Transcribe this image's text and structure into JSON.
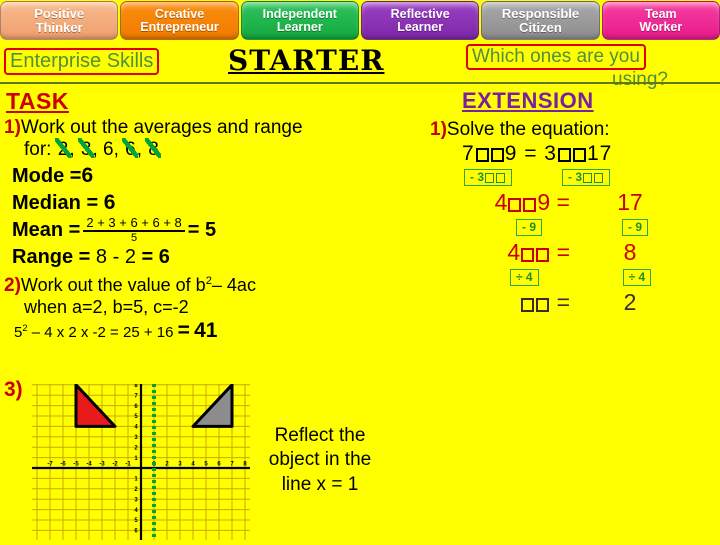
{
  "banner": {
    "skills": [
      {
        "line1": "Positive",
        "line2": "Thinker",
        "color": "#f0a070"
      },
      {
        "line1": "Creative",
        "line2": "Entrepreneur",
        "color": "#f07c00"
      },
      {
        "line1": "Independent",
        "line2": "Learner",
        "color": "#14a83f"
      },
      {
        "line1": "Reflective",
        "line2": "Learner",
        "color": "#7d28a8"
      },
      {
        "line1": "Responsible",
        "line2": "Citizen",
        "color": "#8d8d8d"
      },
      {
        "line1": "Team",
        "line2": "Worker",
        "color": "#e81a8c"
      }
    ]
  },
  "header": {
    "enterprise_skills": "Enterprise Skills",
    "starter": "STARTER",
    "which_ones_line1": "Which ones are you",
    "which_ones_line2": "using?"
  },
  "task": {
    "heading": "TASK",
    "q1_num": "1)",
    "q1_text": "Work out the averages and range",
    "q1_for_label": "for:",
    "q1_values": [
      "2",
      "3",
      "6",
      "6",
      "8"
    ],
    "q1_values_struck": [
      true,
      true,
      false,
      true,
      true
    ],
    "mode_label": "Mode =",
    "mode_value": "6",
    "median_label": "Median =",
    "median_value": "6",
    "mean_label": "Mean =",
    "mean_numerator": "2 + 3 + 6 + 6 + 8",
    "mean_denominator": "5",
    "mean_equals": "=",
    "mean_value": "5",
    "range_label": "Range =",
    "range_expr": "8 - 2",
    "range_equals": "=",
    "range_value": "6",
    "q2_num": "2)",
    "q2_text_pre": "Work out the value of b",
    "q2_sup": "2",
    "q2_text_post": "– 4ac",
    "q2_when": "when a=2, b=5, c=-2",
    "q2_work_base": "5",
    "q2_work_sup": "2",
    "q2_work_rest": "– 4 x 2 x -2 = 25 + 16",
    "q2_work_equals": "=",
    "q2_answer": "41",
    "q3_num": "3)"
  },
  "graph": {
    "x_ticks": [
      "-7",
      "-6",
      "-5",
      "-4",
      "-3",
      "-2",
      "-1",
      "1",
      "2",
      "3",
      "4",
      "5",
      "6",
      "7",
      "8"
    ],
    "y_ticks": [
      "8",
      "7",
      "6",
      "5",
      "4",
      "3",
      "2",
      "1",
      "1",
      "2",
      "3",
      "4",
      "5",
      "6"
    ],
    "x_range": [
      -8,
      8
    ],
    "y_range": [
      -7,
      9
    ],
    "mirror_line_label": "x = 1",
    "mirror_line_x": 1,
    "mirror_line_color": "#00a33c",
    "object_triangle": {
      "points": [
        [
          -5,
          8
        ],
        [
          -5,
          4
        ],
        [
          -2,
          4
        ]
      ],
      "fill": "#e81a1a",
      "stroke": "#000000"
    },
    "image_triangle": {
      "points": [
        [
          7,
          8
        ],
        [
          7,
          4
        ],
        [
          4,
          4
        ]
      ],
      "fill": "#8c8c8c",
      "stroke": "#000000"
    },
    "instruction_line1": "Reflect the",
    "instruction_line2": "object in the",
    "instruction_line3": "line x = 1"
  },
  "extension": {
    "heading": "EXTENSION",
    "q1_num": "1)",
    "q1_text": "Solve the equation:",
    "equation_parts": [
      "7",
      "+",
      "9 = 3",
      "+",
      "17"
    ],
    "step_ops": [
      {
        "label_left": "- 3",
        "label_right": "- 3",
        "color": "#1f8f30"
      },
      {
        "label_left": "- 9",
        "label_right": "- 9",
        "color": "#1f8f30"
      },
      {
        "label_left": "÷ 4",
        "label_right": "÷ 4",
        "color": "#1f8f30"
      }
    ],
    "line2_left_coef": "4",
    "line2_left_tail": "+",
    "line2_left_const": "9 =",
    "line2_right": "17",
    "line3_left_coef": "4",
    "line3_left_eq": "=",
    "line3_right": "8",
    "line4_eq": "=",
    "line4_right": "2"
  }
}
